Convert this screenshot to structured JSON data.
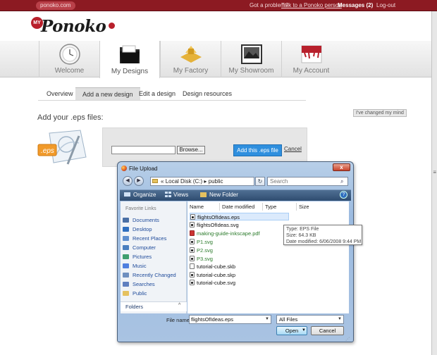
{
  "topbar": {
    "site": "ponoko.com",
    "problem": "Got a problem?",
    "talk": "Talk to a Ponoko person",
    "messages": "Messages (2)",
    "logout": "Log-out"
  },
  "logo": {
    "my": "MY",
    "name": "Ponoko"
  },
  "tabs": [
    {
      "label": "Welcome",
      "icon": "clock-icon"
    },
    {
      "label": "My Designs",
      "icon": "folder-icon"
    },
    {
      "label": "My Factory",
      "icon": "factory-icon"
    },
    {
      "label": "My Showroom",
      "icon": "showroom-icon"
    },
    {
      "label": "My Account",
      "icon": "account-icon"
    }
  ],
  "subnav": [
    "Overview",
    "Add a new design",
    "Edit a design",
    "Design resources"
  ],
  "page": {
    "title": "Add your .eps files:",
    "changed_mind": "I've changed my mind",
    "eps_label": ".eps",
    "browse": "Browse...",
    "add_button": "Add this .eps file",
    "cancel": "Cancel"
  },
  "dialog": {
    "title": "File Upload",
    "close": "x",
    "back": "◀",
    "forward": "▶",
    "path_prefix": "«",
    "path_drive": "Local Disk (C:)",
    "path_sep": "▸",
    "path_folder": "public",
    "refresh": "↻",
    "search_placeholder": "Search",
    "organize": "Organize",
    "views": "Views",
    "new_folder": "New Folder",
    "help": "?",
    "favorite_links": "Favorite Links",
    "nav_items": [
      {
        "label": "Documents",
        "icon": "documents-icon",
        "color": "#4a6fa5"
      },
      {
        "label": "Desktop",
        "icon": "desktop-icon",
        "color": "#2f6fbf"
      },
      {
        "label": "Recent Places",
        "icon": "recent-places-icon",
        "color": "#5f8fcf"
      },
      {
        "label": "Computer",
        "icon": "computer-icon",
        "color": "#4b7fbf"
      },
      {
        "label": "Pictures",
        "icon": "pictures-icon",
        "color": "#3f9f6f"
      },
      {
        "label": "Music",
        "icon": "music-icon",
        "color": "#4f7fdf"
      },
      {
        "label": "Recently Changed",
        "icon": "recently-changed-icon",
        "color": "#6f8fbf"
      },
      {
        "label": "Searches",
        "icon": "searches-icon",
        "color": "#5f7fbf"
      },
      {
        "label": "Public",
        "icon": "public-folder-icon",
        "color": "#e5c15f"
      }
    ],
    "folders": "Folders",
    "columns": [
      "Name",
      "Date modified",
      "Type",
      "Size"
    ],
    "files": [
      {
        "name": "flightsOfIdeas.eps",
        "green": false,
        "icon": "dot",
        "selected": true
      },
      {
        "name": "flightsOfIdeas.svg",
        "green": false,
        "icon": "dot",
        "selected": false
      },
      {
        "name": "making-guide-inkscape.pdf",
        "green": true,
        "icon": "pdf",
        "selected": false
      },
      {
        "name": "P1.svg",
        "green": true,
        "icon": "dot",
        "selected": false
      },
      {
        "name": "P2.svg",
        "green": true,
        "icon": "dot",
        "selected": false
      },
      {
        "name": "P3.svg",
        "green": true,
        "icon": "dot",
        "selected": false
      },
      {
        "name": "tutorial-cube.skb",
        "green": false,
        "icon": "plain",
        "selected": false
      },
      {
        "name": "tutorial-cube.skp",
        "green": false,
        "icon": "dot",
        "selected": false
      },
      {
        "name": "tutorial-cube.svg",
        "green": false,
        "icon": "dot",
        "selected": false
      }
    ],
    "tooltip": {
      "type": "Type: EPS File",
      "size": "Size: 64.3 KB",
      "date": "Date modified: 6/06/2008 9:44 PM"
    },
    "file_name_label": "File name:",
    "file_name_value": "flightsOfIdeas.eps",
    "file_type": "All Files",
    "open": "Open",
    "cancel": "Cancel"
  }
}
